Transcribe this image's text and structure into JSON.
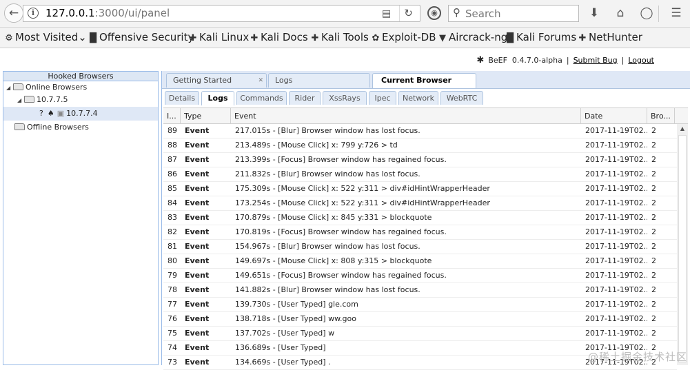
{
  "browser": {
    "url_host": "127.0.0.1",
    "url_path": ":3000/ui/panel",
    "search_placeholder": "Search"
  },
  "bookmarks": [
    {
      "label": "Most Visited",
      "icon": "gear-icon"
    },
    {
      "label": "Offensive Security",
      "icon": "offsec-icon"
    },
    {
      "label": "Kali Linux",
      "icon": "kali-dragon-icon"
    },
    {
      "label": "Kali Docs",
      "icon": "kali-dragon-icon"
    },
    {
      "label": "Kali Tools",
      "icon": "kali-dragon-icon"
    },
    {
      "label": "Exploit-DB",
      "icon": "bug-icon"
    },
    {
      "label": "Aircrack-ng",
      "icon": "aircrack-icon"
    },
    {
      "label": "Kali Forums",
      "icon": "offsec-icon"
    },
    {
      "label": "NetHunter",
      "icon": "kali-dragon-icon"
    }
  ],
  "header": {
    "product": "BeEF",
    "version": "0.4.7.0-alpha",
    "submit_bug": "Submit  Bug",
    "logout": "Logout"
  },
  "tree": {
    "title": "Hooked Browsers",
    "online": "Online Browsers",
    "ip_group": "10.7.7.5",
    "host": "10.7.7.4",
    "offline": "Offline Browsers"
  },
  "main_tabs": [
    {
      "label": "Getting Started",
      "closable": true
    },
    {
      "label": "Logs",
      "closable": false
    },
    {
      "label": "Current Browser",
      "closable": false,
      "active": true
    }
  ],
  "sub_tabs": [
    {
      "label": "Details"
    },
    {
      "label": "Logs",
      "active": true
    },
    {
      "label": "Commands"
    },
    {
      "label": "Rider"
    },
    {
      "label": "XssRays"
    },
    {
      "label": "Ipec"
    },
    {
      "label": "Network"
    },
    {
      "label": "WebRTC"
    }
  ],
  "log_table": {
    "columns": [
      "I...",
      "Type",
      "Event",
      "Date",
      "Bro..."
    ],
    "rows": [
      [
        "89",
        "Event",
        "217.015s - [Blur] Browser window has lost focus.",
        "2017-11-19T02...",
        "2"
      ],
      [
        "88",
        "Event",
        "213.489s - [Mouse Click] x: 799 y:726 > td",
        "2017-11-19T02...",
        "2"
      ],
      [
        "87",
        "Event",
        "213.399s - [Focus] Browser window has regained focus.",
        "2017-11-19T02...",
        "2"
      ],
      [
        "86",
        "Event",
        "211.832s - [Blur] Browser window has lost focus.",
        "2017-11-19T02...",
        "2"
      ],
      [
        "85",
        "Event",
        "175.309s - [Mouse Click] x: 522 y:311 > div#idHintWrapperHeader",
        "2017-11-19T02...",
        "2"
      ],
      [
        "84",
        "Event",
        "173.254s - [Mouse Click] x: 522 y:311 > div#idHintWrapperHeader",
        "2017-11-19T02...",
        "2"
      ],
      [
        "83",
        "Event",
        "170.879s - [Mouse Click] x: 845 y:331 > blockquote",
        "2017-11-19T02...",
        "2"
      ],
      [
        "82",
        "Event",
        "170.819s - [Focus] Browser window has regained focus.",
        "2017-11-19T02...",
        "2"
      ],
      [
        "81",
        "Event",
        "154.967s - [Blur] Browser window has lost focus.",
        "2017-11-19T02...",
        "2"
      ],
      [
        "80",
        "Event",
        "149.697s - [Mouse Click] x: 808 y:315 > blockquote",
        "2017-11-19T02...",
        "2"
      ],
      [
        "79",
        "Event",
        "149.651s - [Focus] Browser window has regained focus.",
        "2017-11-19T02...",
        "2"
      ],
      [
        "78",
        "Event",
        "141.882s - [Blur] Browser window has lost focus.",
        "2017-11-19T02...",
        "2"
      ],
      [
        "77",
        "Event",
        "139.730s - [User Typed] gle.com",
        "2017-11-19T02...",
        "2"
      ],
      [
        "76",
        "Event",
        "138.718s - [User Typed] ww.goo",
        "2017-11-19T02...",
        "2"
      ],
      [
        "75",
        "Event",
        "137.702s - [User Typed] w",
        "2017-11-19T02...",
        "2"
      ],
      [
        "74",
        "Event",
        "136.689s - [User Typed]",
        "2017-11-19T02...",
        "2"
      ],
      [
        "73",
        "Event",
        "134.669s - [User Typed] .",
        "2017-11-19T02...",
        "2"
      ]
    ]
  },
  "watermark": "@稀土掘金技术社区"
}
